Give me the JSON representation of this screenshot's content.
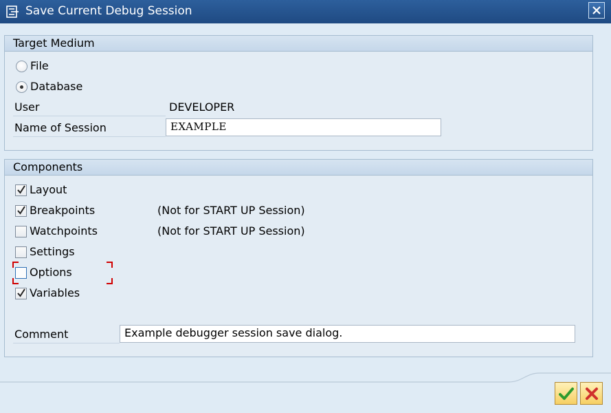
{
  "window": {
    "title": "Save Current Debug Session"
  },
  "target_medium": {
    "header": "Target Medium",
    "options": [
      {
        "label": "File",
        "selected": false
      },
      {
        "label": "Database",
        "selected": true
      }
    ],
    "user_label": "User",
    "user_value": "DEVELOPER",
    "session_name_label": "Name of Session",
    "session_name_value": "EXAMPLE"
  },
  "components": {
    "header": "Components",
    "items": [
      {
        "label": "Layout",
        "checked": true,
        "note": ""
      },
      {
        "label": "Breakpoints",
        "checked": true,
        "note": "(Not for START UP Session)"
      },
      {
        "label": "Watchpoints",
        "checked": false,
        "note": "(Not for START UP Session)"
      },
      {
        "label": "Settings",
        "checked": false,
        "note": ""
      },
      {
        "label": "Options",
        "checked": false,
        "note": ""
      },
      {
        "label": "Variables",
        "checked": true,
        "note": ""
      }
    ],
    "comment_label": "Comment",
    "comment_value": "Example debugger session save dialog."
  },
  "colors": {
    "title_bar": "#1f4a82",
    "dialog_background": "#dfebf5",
    "focus_marker": "#d00000",
    "ok_check": "#2e9b2e",
    "cancel_x": "#d0312d"
  },
  "icons": {
    "title": "dialog-icon",
    "close": "close-icon",
    "ok": "check-icon",
    "cancel": "cancel-icon"
  }
}
